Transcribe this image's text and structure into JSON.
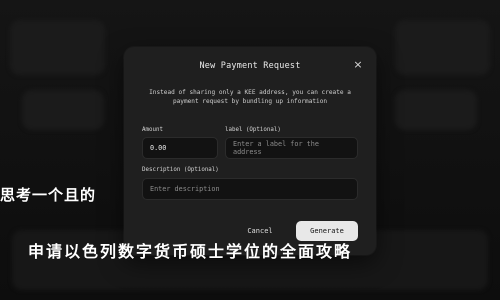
{
  "modal": {
    "title": "New Payment Request",
    "close_symbol": "×",
    "description": "Instead of sharing only a KEE address, you can create a payment request by bundling up information",
    "amount": {
      "label": "Amount",
      "value": "0.00"
    },
    "label_field": {
      "label": "label (Optional)",
      "placeholder": "Enter a label for the address"
    },
    "description_field": {
      "label": "Description (Optional)",
      "placeholder": "Enter description"
    },
    "buttons": {
      "cancel": "Cancel",
      "generate": "Generate"
    }
  },
  "overlay": {
    "line1": "思考一个且的",
    "line2": "申请以色列数字货币硕士学位的全面攻略"
  },
  "colors": {
    "background": "#0d0d0d",
    "modal": "#1f1f1f",
    "primary_button": "#e8e8e8"
  },
  "icons": {
    "close": "close-icon"
  }
}
